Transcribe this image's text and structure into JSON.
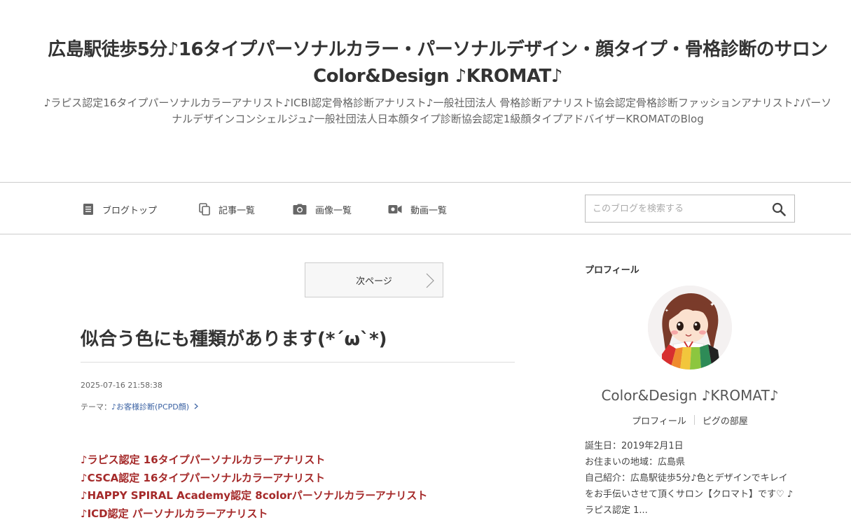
{
  "header": {
    "title": "広島駅徒歩5分♪16タイプパーソナルカラー・パーソナルデザイン・顔タイプ・骨格診断のサロン Color&Design ♪KROMAT♪",
    "description": "♪ラピス認定16タイプパーソナルカラーアナリスト♪ICBI認定骨格診断アナリスト♪一般社団法人 骨格診断アナリスト協会認定骨格診断ファッションアナリスト♪パーソナルデザインコンシェルジュ♪一般社団法人日本顔タイプ診断協会認定1級顔タイプアドバイザーKROMATのBlog"
  },
  "nav": {
    "items": [
      {
        "label": "ブログトップ",
        "icon": "document-icon"
      },
      {
        "label": "記事一覧",
        "icon": "copy-icon"
      },
      {
        "label": "画像一覧",
        "icon": "camera-icon"
      },
      {
        "label": "動画一覧",
        "icon": "video-icon"
      }
    ],
    "search_placeholder": "このブログを検索する",
    "search_icon": "search-icon"
  },
  "main": {
    "next_page_label": "次ページ",
    "entry_title": "似合う色にも種類があります(*´ω`*)",
    "entry_date": "2025-07-16 21:58:38",
    "theme_label": "テーマ：",
    "theme_link": "♪お客様診断(PCPD顔)",
    "body_lines": [
      "♪ラピス認定 16タイプパーソナルカラーアナリスト",
      "♪CSCA認定 16タイプパーソナルカラーアナリスト",
      "♪HAPPY SPIRAL Academy認定 8colorパーソナルカラーアナリスト",
      "♪ICD認定 パーソナルカラーアナリスト"
    ],
    "accent_color": "#a52a2a"
  },
  "sidebar": {
    "heading": "プロフィール",
    "name": "Color&Design ♪KROMAT♪",
    "links": [
      "プロフィール",
      "ピグの部屋"
    ],
    "birthday": "誕生日：2019年2月1日",
    "region": "お住まいの地域：広島県",
    "intro": "自己紹介：広島駅徒歩5分♪色とデザインでキレイをお手伝いさせて頂くサロン【クロマト】です♡ ♪ラピス認定 1..."
  }
}
